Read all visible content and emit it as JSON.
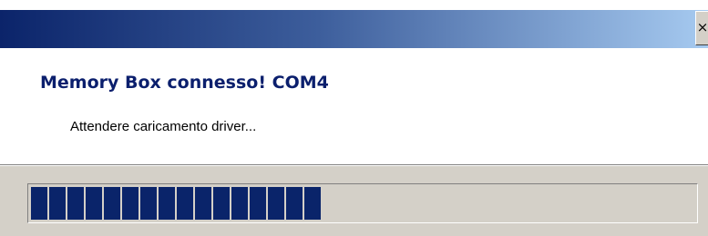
{
  "window": {
    "close_glyph": "×",
    "title_gradient_start": "#0b246a",
    "title_gradient_end": "#a6caf0"
  },
  "header": {
    "title": "Memory Box connesso! COM4",
    "subtitle": "Attendere caricamento driver..."
  },
  "progress": {
    "fraction": 0.45,
    "bar_color": "#0a246a"
  }
}
